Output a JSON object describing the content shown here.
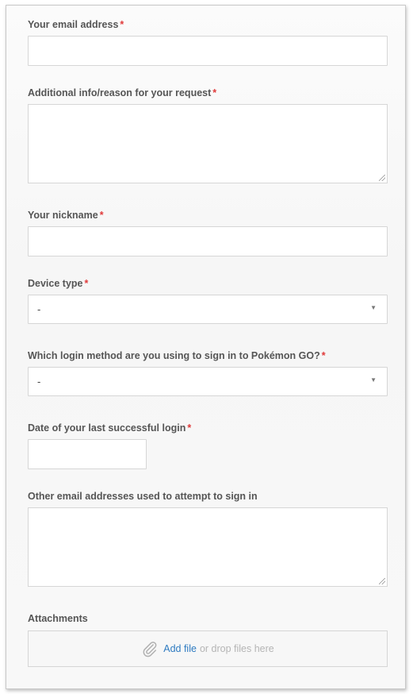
{
  "form": {
    "email": {
      "label": "Your email address",
      "required_mark": "*",
      "value": ""
    },
    "additional_info": {
      "label": "Additional info/reason for your request",
      "required_mark": "*",
      "value": ""
    },
    "nickname": {
      "label": "Your nickname",
      "required_mark": "*",
      "value": ""
    },
    "device_type": {
      "label": "Device type",
      "required_mark": "*",
      "selected": "-"
    },
    "login_method": {
      "label": "Which login method are you using to sign in to Pokémon GO?",
      "required_mark": "*",
      "selected": "-"
    },
    "last_login": {
      "label": "Date of your last successful login",
      "required_mark": "*",
      "value": ""
    },
    "other_emails": {
      "label": "Other email addresses used to attempt to sign in",
      "value": ""
    },
    "attachments": {
      "label": "Attachments",
      "add_file": "Add file",
      "drop_text": "or drop files here",
      "icon": "paperclip-icon"
    }
  },
  "colors": {
    "required": "#e03a3a",
    "link": "#2e7bc1",
    "border": "#d6d6d6"
  }
}
